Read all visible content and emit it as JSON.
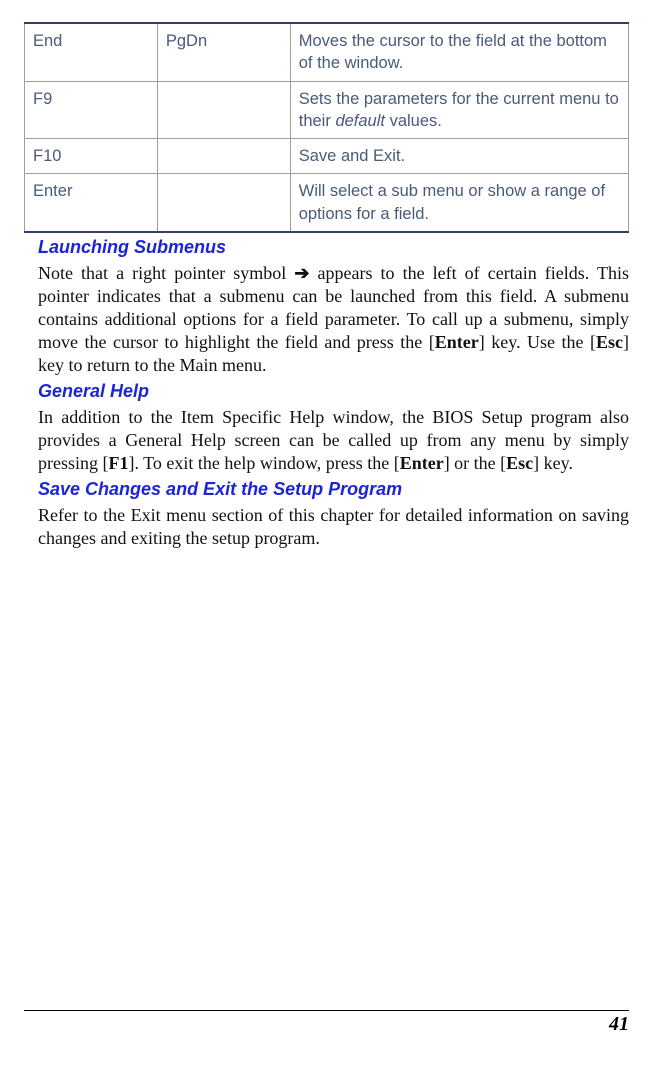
{
  "table": {
    "rows": [
      {
        "key": "End",
        "alt": "PgDn",
        "desc_a": "Moves the cursor to the field at the bottom of the window.",
        "desc_b": ""
      },
      {
        "key": "F9",
        "alt": "",
        "desc_a": "Sets the parameters for the current menu to their ",
        "desc_b": " values.",
        "italic": "default"
      },
      {
        "key": "F10",
        "alt": "",
        "desc_a": "Save and Exit.",
        "desc_b": ""
      },
      {
        "key": "Enter",
        "alt": "",
        "desc_a": "Will select a sub menu or show a range of options for a field.",
        "desc_b": ""
      }
    ]
  },
  "sections": {
    "launching": {
      "title": "Launching Submenus",
      "p_a": "Note that a right pointer symbol ",
      "arrow": "➔",
      "p_b": " appears to the left of certain fields. This pointer indicates that a submenu can be launched from this field. A submenu contains additional options for a field parameter. To call up a submenu, simply move the cursor to highlight the field and press the [",
      "enter": "Enter",
      "p_c": "] key. Use the [",
      "esc": "Esc",
      "p_d": "] key to return to the Main menu."
    },
    "general": {
      "title": "General Help",
      "p_a": "In addition to the Item Specific Help window, the BIOS Setup program also provides a General Help screen can be called up from any menu by simply pressing [",
      "f1": "F1",
      "p_b": "].  To exit the help window, press the [",
      "enter": "Enter",
      "p_c": "] or the [",
      "esc": "Esc",
      "p_d": "] key."
    },
    "save": {
      "title": "Save Changes and Exit the Setup Program",
      "p": "Refer to the Exit menu section of this chapter for detailed information on saving changes and exiting the setup program."
    }
  },
  "page_number": "41"
}
